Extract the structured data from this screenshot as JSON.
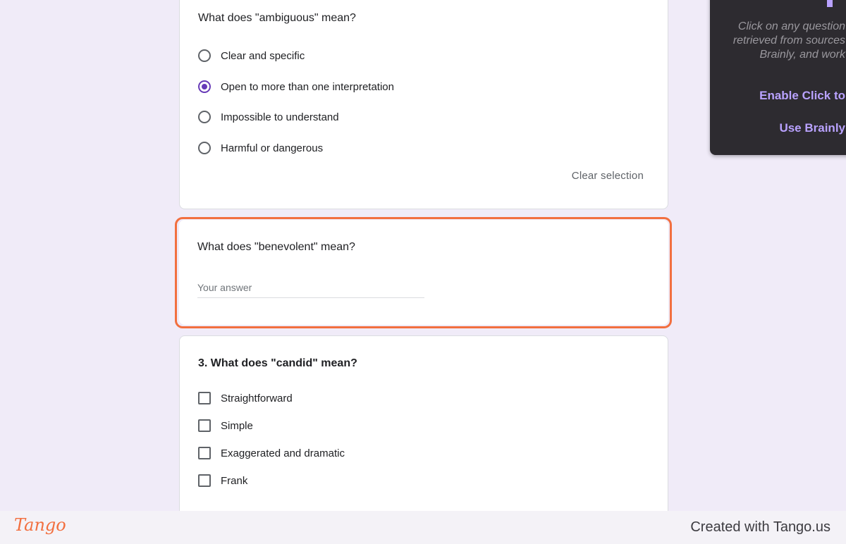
{
  "questions": {
    "q1": {
      "title": "What does \"ambiguous\" mean?",
      "options": [
        {
          "label": "Clear and specific",
          "selected": false
        },
        {
          "label": "Open to more than one interpretation",
          "selected": true
        },
        {
          "label": "Impossible to understand",
          "selected": false
        },
        {
          "label": "Harmful or dangerous",
          "selected": false
        }
      ],
      "clear_label": "Clear selection"
    },
    "q2": {
      "title": "What does \"benevolent\" mean?",
      "placeholder": "Your answer",
      "value": ""
    },
    "q3": {
      "title": "3. What does \"candid\" mean?",
      "options": [
        {
          "label": "Straightforward",
          "checked": false
        },
        {
          "label": "Simple",
          "checked": false
        },
        {
          "label": "Exaggerated and dramatic",
          "checked": false
        },
        {
          "label": "Frank",
          "checked": false
        }
      ]
    }
  },
  "extension": {
    "description": "Click on any question retrieved from sources Brainly, and work",
    "enable_label": "Enable Click to",
    "brainly_label": "Use Brainly"
  },
  "footer": {
    "logo": "Tango",
    "credit": "Created with Tango.us"
  },
  "colors": {
    "accent": "#673ab7",
    "highlight": "#f26f3f",
    "page_background": "#f0ebf8"
  }
}
